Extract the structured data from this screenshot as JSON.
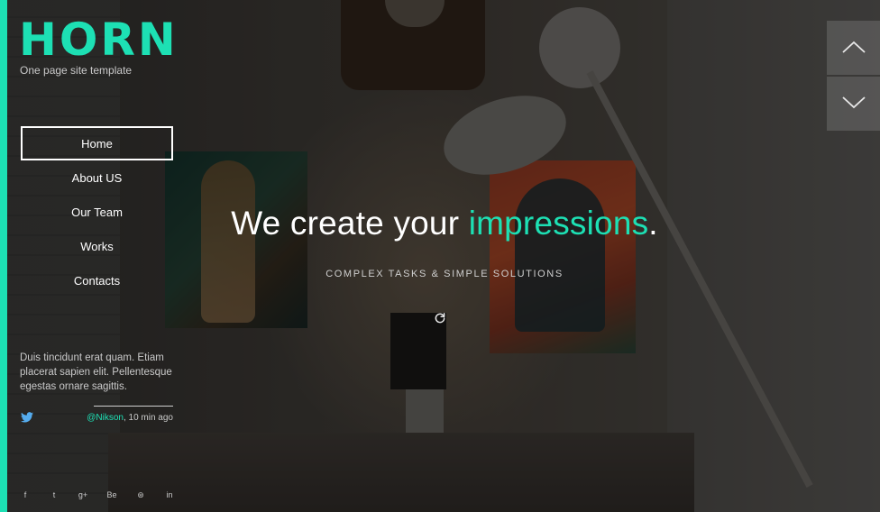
{
  "brand": {
    "logo": "HORN",
    "tagline": "One page site template",
    "accent_color": "#1de0b4"
  },
  "nav": {
    "items": [
      {
        "label": "Home",
        "active": true
      },
      {
        "label": "About US",
        "active": false
      },
      {
        "label": "Our Team",
        "active": false
      },
      {
        "label": "Works",
        "active": false
      },
      {
        "label": "Contacts",
        "active": false
      }
    ]
  },
  "hero": {
    "title_prefix": "We create your ",
    "title_highlight": "impressions",
    "title_suffix": ".",
    "subtitle": "COMPLEX TASKS & SIMPLE SOLUTIONS",
    "reload_icon": "reload-icon"
  },
  "tweet": {
    "text": "Duis tincidunt erat quam. Etiam placerat sapien elit. Pellentesque egestas ornare sagittis.",
    "handle": "@Nikson",
    "time": ", 10 min ago",
    "icon": "twitter-icon"
  },
  "social": {
    "icons": [
      {
        "name": "facebook-icon",
        "glyph": "f"
      },
      {
        "name": "twitter-icon",
        "glyph": "t"
      },
      {
        "name": "google-plus-icon",
        "glyph": "g+"
      },
      {
        "name": "behance-icon",
        "glyph": "Be"
      },
      {
        "name": "dribbble-icon",
        "glyph": "⊛"
      },
      {
        "name": "linkedin-icon",
        "glyph": "in"
      }
    ]
  },
  "arrows": {
    "up_icon": "chevron-up-icon",
    "down_icon": "chevron-down-icon"
  }
}
